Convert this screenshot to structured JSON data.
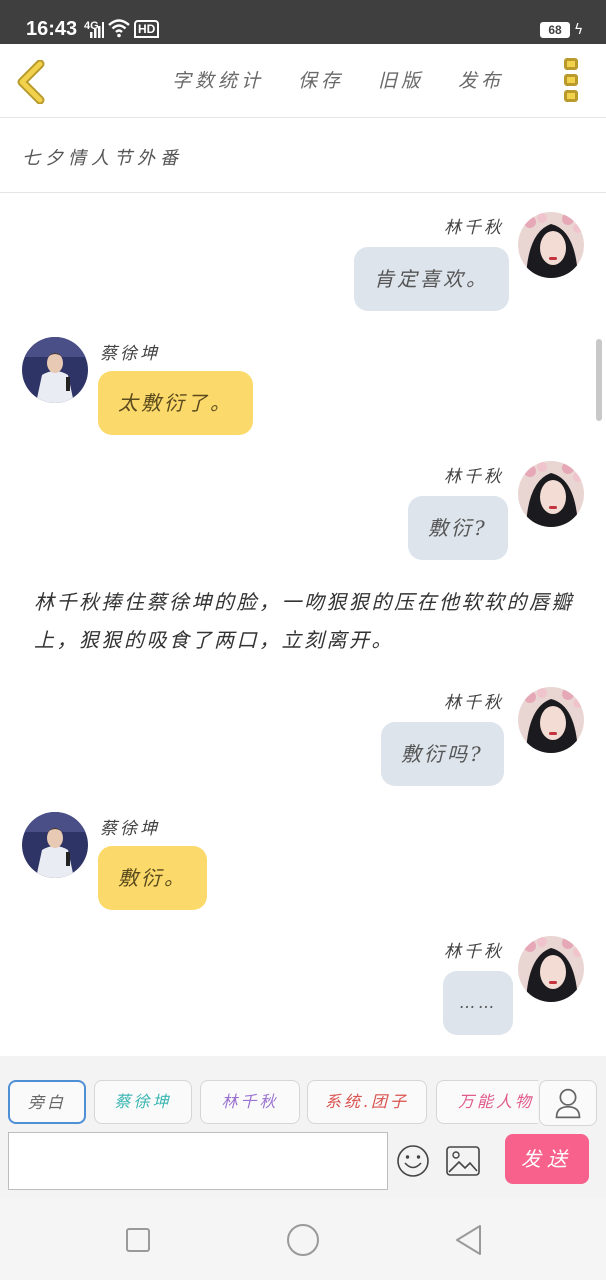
{
  "status": {
    "time": "16:43",
    "network": "4G",
    "hd": "HD",
    "battery": "68"
  },
  "header": {
    "menu": [
      "字数统计",
      "保存",
      "旧版",
      "发布"
    ]
  },
  "chapter_title": "七夕情人节外番",
  "messages": [
    {
      "side": "right",
      "speaker": "林千秋",
      "text": "肯定喜欢。"
    },
    {
      "side": "left",
      "speaker": "蔡徐坤",
      "text": "太敷衍了。"
    },
    {
      "side": "right",
      "speaker": "林千秋",
      "text": "敷衍?"
    },
    {
      "side": "narration",
      "text": "林千秋捧住蔡徐坤的脸，一吻狠狠的压在他软软的唇瓣上，狠狠的吸食了两口，立刻离开。"
    },
    {
      "side": "right",
      "speaker": "林千秋",
      "text": "敷衍吗?"
    },
    {
      "side": "left",
      "speaker": "蔡徐坤",
      "text": "敷衍。"
    },
    {
      "side": "right",
      "speaker": "林千秋",
      "text": "……"
    }
  ],
  "roles": [
    "旁白",
    "蔡徐坤",
    "林千秋",
    "系统.团子",
    "万能人物"
  ],
  "role_colors": [
    "#666666",
    "#3bb7b3",
    "#9b72cf",
    "#d9534f",
    "#e05a8a"
  ],
  "input": {
    "value": "",
    "placeholder": ""
  },
  "send_label": "发送",
  "icons": [
    "back-icon",
    "more-icon",
    "user-icon",
    "emoji-icon",
    "image-icon",
    "send-icon",
    "nav-recent-icon",
    "nav-home-icon",
    "nav-back-icon"
  ],
  "colors": {
    "accent_yellow": "#f2d14d",
    "send_pink": "#f7618c",
    "right_bubble": "#dde4ec",
    "left_bubble": "#fbd96a"
  }
}
